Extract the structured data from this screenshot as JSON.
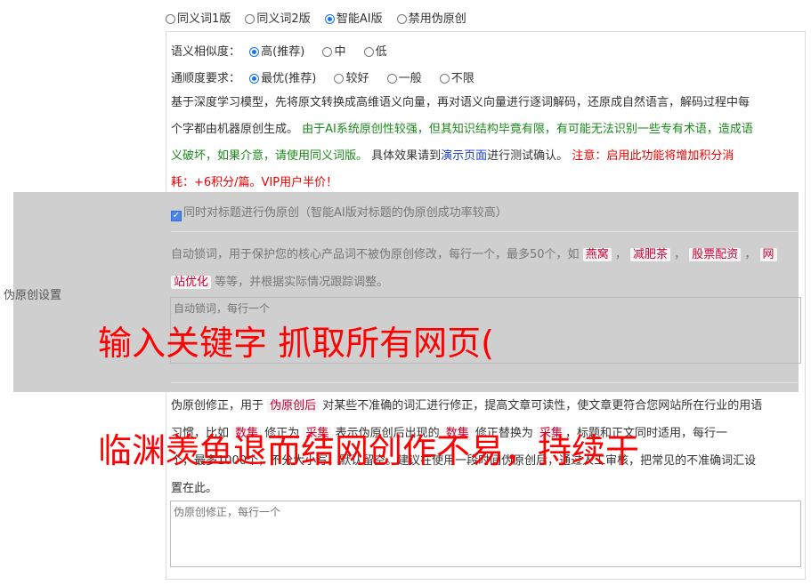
{
  "modes": [
    "同义词1版",
    "同义词2版",
    "智能AI版",
    "禁用伪原创"
  ],
  "selected_mode": "智能AI版",
  "similarity": {
    "label": "语义相似度：",
    "options": [
      "高(推荐)",
      "中",
      "低"
    ],
    "selected": "高(推荐)"
  },
  "fluency": {
    "label": "通顺度要求：",
    "options": [
      "最优(推荐)",
      "较好",
      "一般",
      "不限"
    ],
    "selected": "最优(推荐)"
  },
  "description": {
    "p1": "基于深度学习模型，先将原文转换成高维语义向量，再对语义向量进行逐词解码，还原成自然语言，解码过程中每",
    "p2a": "个字都由机器原创生成。 ",
    "p2b": "由于AI系统原创性较强，但其知识结构毕竟有限，有可能无法识别一些专有术语，造成语",
    "p3a": "义破坏，如果介意，请使用同义词版。",
    "p3b": " 具体效果请到",
    "p3c": "演示页面",
    "p3d": "进行测试确认。 ",
    "p3e": "注意：启用此功能将增加积分消",
    "p4": "耗：+6积分/篇。VIP用户半价！"
  },
  "side_label": "伪原创设置",
  "title_option": "同时对标题进行伪原创（智能AI版对标题的伪原创成功率较高）",
  "lock_words": {
    "text_a": "自动锁词，用于保护您的核心产品词不被伪原创修改，每行一个，最多50个，如 ",
    "tags": [
      "燕窝",
      "减肥茶",
      "股票配资",
      "网"
    ],
    "tag_last_cont": "站优化",
    "text_b": " 等等，并根据实际情况跟踪调整。",
    "placeholder": "自动锁词，每行一个"
  },
  "correction": {
    "line1a": "伪原创修正，用于 ",
    "line1tag": "伪原创后",
    "line1b": " 对某些不准确的词汇进行修正，提高文章可读性，使文章更符合您网站所在行业的用语",
    "line2a": "习惯，比如 ",
    "line2tag1": "数集",
    "line2b": " 修正为 ",
    "line2tag2": "采集",
    "line2c": " 表示伪原创后出现的 ",
    "line2tag3": "数集",
    "line2d": " 修正替换为 ",
    "line2tag4": "采集",
    "line2e": "，标题和正文同时适用，每行一",
    "line3": "个，最多1000个，不分大小写，默认留空。建议在使用一段时间伪原创后，通过人工审核，把常见的不准确词汇设",
    "line4": "置在此。",
    "placeholder": "伪原创修正，每行一个"
  },
  "watermark": {
    "line1": "输入关键字 抓取所有网页(",
    "line2": "临渊羡鱼退而结网创作不易，持续干"
  }
}
